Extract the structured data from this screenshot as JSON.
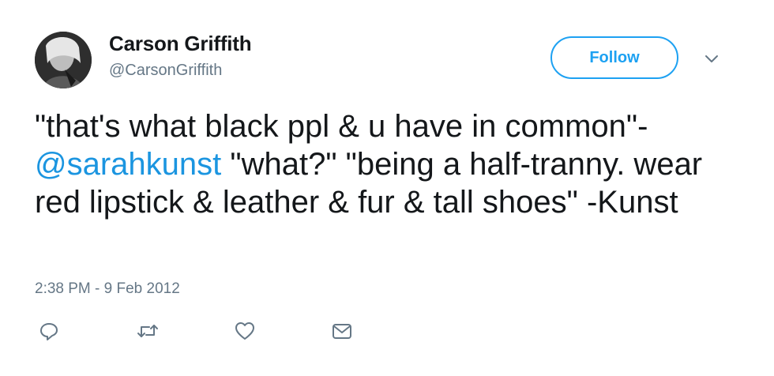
{
  "tweet": {
    "author_name": "Carson Griffith",
    "author_handle": "@CarsonGriffith",
    "follow_label": "Follow",
    "text_segments": [
      "\"that's what black ppl & u have in common\"- ",
      "@sarahkunst",
      " \"what?\" \"being a half-tranny. wear red lipstick & leather & fur & tall shoes\" -Kunst"
    ],
    "timestamp": "2:38 PM - 9 Feb 2012"
  },
  "icons": {
    "reply": "reply-icon",
    "retweet": "retweet-icon",
    "like": "heart-icon",
    "message": "envelope-icon",
    "more": "chevron-down-icon"
  },
  "colors": {
    "accent": "#1da1f2",
    "mention": "#1b95e0",
    "secondary_text": "#657786",
    "icon_gray": "#657786"
  }
}
